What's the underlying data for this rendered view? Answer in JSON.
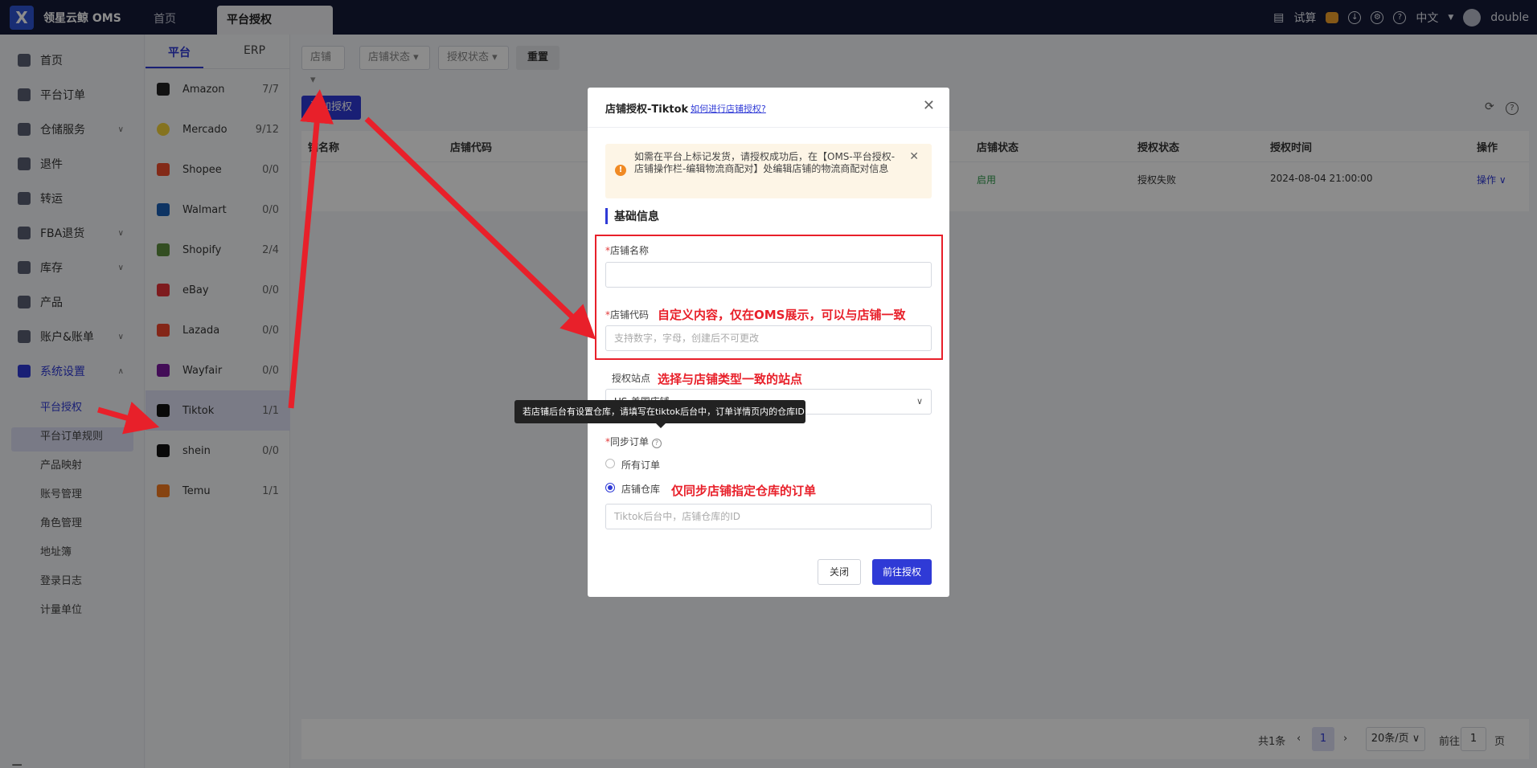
{
  "app": {
    "logo": "X",
    "title": "领星云鲸 OMS"
  },
  "top_tabs": {
    "home": "首页",
    "active": "平台授权"
  },
  "top_right": {
    "trial": "试算",
    "language": "中文",
    "user": "double"
  },
  "sidebar": {
    "items": [
      {
        "label": "首页"
      },
      {
        "label": "平台订单"
      },
      {
        "label": "仓储服务"
      },
      {
        "label": "退件"
      },
      {
        "label": "转运"
      },
      {
        "label": "FBA退货"
      },
      {
        "label": "库存"
      },
      {
        "label": "产品"
      },
      {
        "label": "账户&账单"
      },
      {
        "label": "系统设置"
      }
    ],
    "sub_items": [
      {
        "label": "平台授权"
      },
      {
        "label": "平台订单规则"
      },
      {
        "label": "产品映射"
      },
      {
        "label": "账号管理"
      },
      {
        "label": "角色管理"
      },
      {
        "label": "地址簿"
      },
      {
        "label": "登录日志"
      },
      {
        "label": "计量单位"
      }
    ]
  },
  "platform_panel": {
    "tabs": [
      "平台",
      "ERP"
    ],
    "platforms": [
      {
        "name": "Amazon",
        "count": "7/7"
      },
      {
        "name": "Mercado",
        "count": "9/12"
      },
      {
        "name": "Shopee",
        "count": "0/0"
      },
      {
        "name": "Walmart",
        "count": "0/0"
      },
      {
        "name": "Shopify",
        "count": "2/4"
      },
      {
        "name": "eBay",
        "count": "0/0"
      },
      {
        "name": "Lazada",
        "count": "0/0"
      },
      {
        "name": "Wayfair",
        "count": "0/0"
      },
      {
        "name": "Tiktok",
        "count": "1/1"
      },
      {
        "name": "shein",
        "count": "0/0"
      },
      {
        "name": "Temu",
        "count": "1/1"
      }
    ]
  },
  "filters": {
    "shop": "店铺",
    "shop_status": "店铺状态",
    "auth_status": "授权状态",
    "reset": "重置"
  },
  "add_button": "添加授权",
  "table": {
    "headers": [
      "铺名称",
      "店铺代码",
      "店铺状态",
      "授权状态",
      "授权时间",
      "操作"
    ],
    "row": {
      "shop_status": "启用",
      "auth_status": "授权失败",
      "auth_time": "2024-08-04 21:00:00",
      "action": "操作"
    }
  },
  "pager": {
    "total": "共1条",
    "page": "1",
    "page_size": "20条/页",
    "goto": "前往",
    "goto_value": "1",
    "page_suffix": "页"
  },
  "modal": {
    "title": "店铺授权-Tiktok",
    "help_link": "如何进行店铺授权?",
    "alert": "如需在平台上标记发货，请授权成功后，在【OMS-平台授权-店铺操作栏-编辑物流商配对】处编辑店铺的物流商配对信息",
    "section": "基础信息",
    "shop_name_label": "店铺名称",
    "shop_code_label": "店铺代码",
    "shop_code_placeholder": "支持数字，字母，创建后不可更改",
    "site_label": "授权站点",
    "site_value": "US-美国店铺",
    "sync_label": "同步订单",
    "radio_all": "所有订单",
    "radio_warehouse": "店铺仓库",
    "warehouse_placeholder": "Tiktok后台中，店铺仓库的ID",
    "close": "关闭",
    "go": "前往授权"
  },
  "tooltip": "若店铺后台有设置仓库，请填写在tiktok后台中，订单详情页内的仓库ID",
  "annotations": {
    "shop_code": "自定义内容，仅在OMS展示，可以与店铺一致",
    "site": "选择与店铺类型一致的站点",
    "warehouse": "仅同步店铺指定仓库的订单"
  },
  "colors": {
    "accent": "#2f3ad6",
    "annotation": "#e8202a",
    "topbar": "#141a38"
  }
}
